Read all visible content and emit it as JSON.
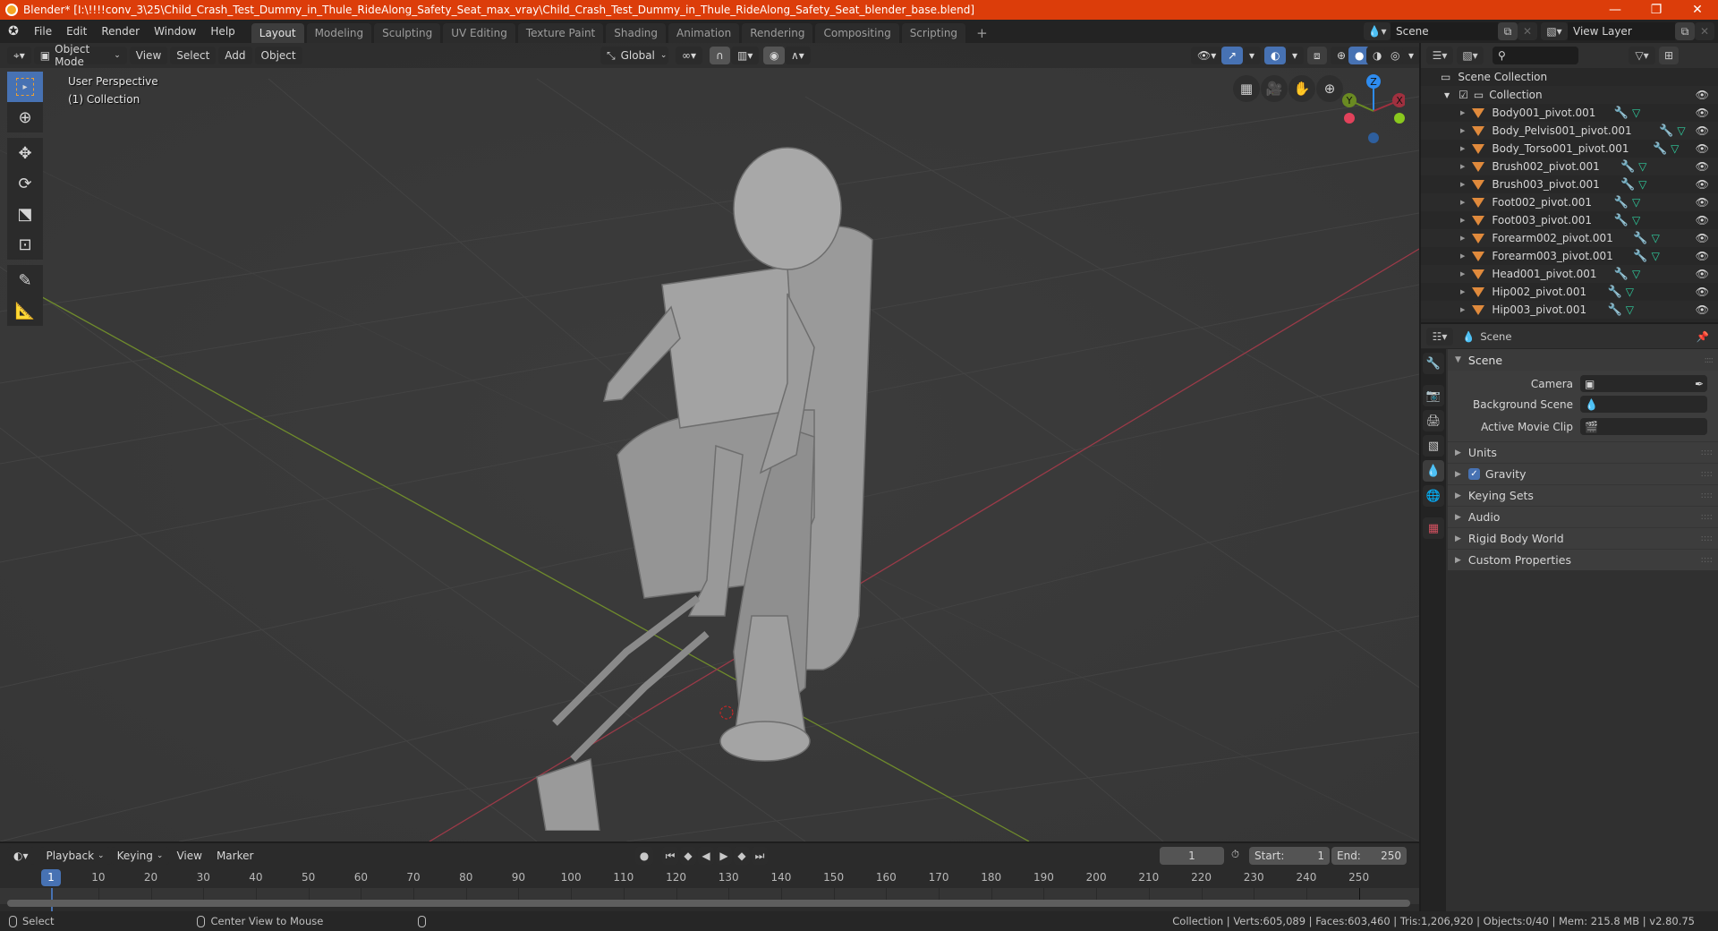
{
  "window": {
    "title": "Blender* [I:\\!!!!conv_3\\25\\Child_Crash_Test_Dummy_in_Thule_RideAlong_Safety_Seat_max_vray\\Child_Crash_Test_Dummy_in_Thule_RideAlong_Safety_Seat_blender_base.blend]",
    "controls": {
      "minimize": "—",
      "maximize": "❐",
      "close": "✕"
    }
  },
  "menu": [
    "File",
    "Edit",
    "Render",
    "Window",
    "Help"
  ],
  "workspaces": [
    {
      "label": "Layout",
      "active": true
    },
    {
      "label": "Modeling",
      "active": false
    },
    {
      "label": "Sculpting",
      "active": false
    },
    {
      "label": "UV Editing",
      "active": false
    },
    {
      "label": "Texture Paint",
      "active": false
    },
    {
      "label": "Shading",
      "active": false
    },
    {
      "label": "Animation",
      "active": false
    },
    {
      "label": "Rendering",
      "active": false
    },
    {
      "label": "Compositing",
      "active": false
    },
    {
      "label": "Scripting",
      "active": false
    }
  ],
  "add_workspace": "+",
  "scene_selector": {
    "value": "Scene"
  },
  "view_layer_selector": {
    "value": "View Layer"
  },
  "viewport": {
    "mode": "Object Mode",
    "menus": [
      "View",
      "Select",
      "Add",
      "Object"
    ],
    "transform_orientation": "Global",
    "overlay_line1": "User Perspective",
    "overlay_line2": "(1) Collection",
    "gizmo_axes": {
      "x": "X",
      "y": "Y",
      "z": "Z"
    },
    "tools": [
      "select-box",
      "cursor",
      "move",
      "rotate",
      "scale",
      "transform",
      "annotate",
      "measure"
    ],
    "shading_active": "solid"
  },
  "outliner": {
    "root": "Scene Collection",
    "collection": "Collection",
    "objects": [
      "Body001_pivot.001",
      "Body_Pelvis001_pivot.001",
      "Body_Torso001_pivot.001",
      "Brush002_pivot.001",
      "Brush003_pivot.001",
      "Foot002_pivot.001",
      "Foot003_pivot.001",
      "Forearm002_pivot.001",
      "Forearm003_pivot.001",
      "Head001_pivot.001",
      "Hip002_pivot.001",
      "Hip003_pivot.001"
    ]
  },
  "properties": {
    "context": "Scene",
    "panel_title": "Scene",
    "fields": [
      {
        "label": "Camera",
        "value": ""
      },
      {
        "label": "Background Scene",
        "value": ""
      },
      {
        "label": "Active Movie Clip",
        "value": ""
      }
    ],
    "subpanels": [
      {
        "label": "Units",
        "checkbox": false
      },
      {
        "label": "Gravity",
        "checkbox": true,
        "checked": true
      },
      {
        "label": "Keying Sets",
        "checkbox": false
      },
      {
        "label": "Audio",
        "checkbox": false
      },
      {
        "label": "Rigid Body World",
        "checkbox": false
      },
      {
        "label": "Custom Properties",
        "checkbox": false
      }
    ]
  },
  "timeline": {
    "menus": [
      "Playback",
      "Keying",
      "View",
      "Marker"
    ],
    "current_frame": "1",
    "start_label": "Start:",
    "start": "1",
    "end_label": "End:",
    "end": "250",
    "ruler_ticks": [
      "10",
      "20",
      "30",
      "40",
      "50",
      "60",
      "70",
      "80",
      "90",
      "100",
      "110",
      "120",
      "130",
      "140",
      "150",
      "160",
      "170",
      "180",
      "190",
      "200",
      "210",
      "220",
      "230",
      "240",
      "250"
    ],
    "playhead_label": "1"
  },
  "statusbar": {
    "left_action": "Select",
    "middle_action": "Center View to Mouse",
    "stats": "Collection | Verts:605,089 | Faces:603,460 | Tris:1,206,920 | Objects:0/40 | Mem: 215.8 MB | v2.80.75"
  },
  "colors": {
    "titlebar": "#dc3d0a",
    "accent_blue": "#4772b3",
    "object_icon": "#e08a3c",
    "axis_x": "#e2425b",
    "axis_y": "#8ac81e",
    "axis_z": "#2e8cf0"
  }
}
